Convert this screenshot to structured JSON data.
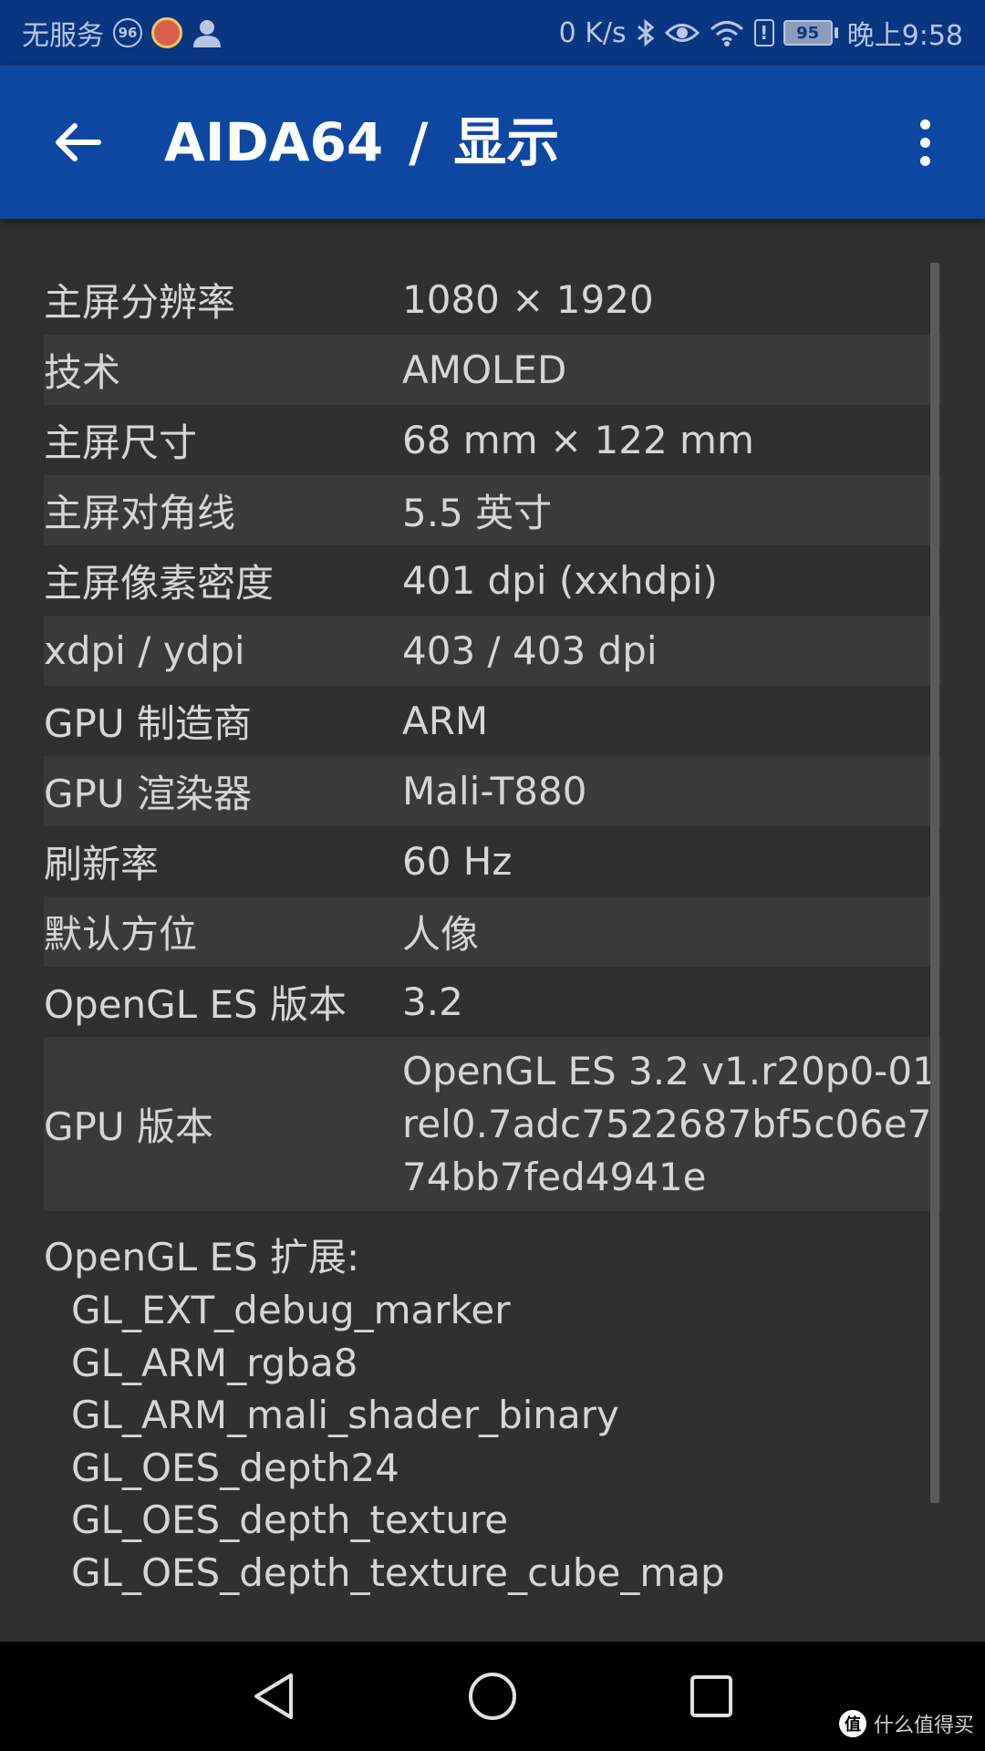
{
  "status_bar": {
    "carrier": "无服务",
    "notification_count": "96",
    "network_speed": "0 K/s",
    "battery": "95",
    "time": "晚上9:58",
    "icons": [
      "user-icon",
      "bluetooth-icon",
      "eye-icon",
      "wifi-icon",
      "alert-icon",
      "battery-icon"
    ]
  },
  "app_bar": {
    "app_name": "AIDA64",
    "separator": "/",
    "section": "显示",
    "back_icon": "arrow-left-icon",
    "menu_icon": "more-vert-icon"
  },
  "rows": [
    {
      "label": "主屏分辨率",
      "value": "1080 × 1920"
    },
    {
      "label": "技术",
      "value": "AMOLED"
    },
    {
      "label": "主屏尺寸",
      "value": "68 mm × 122 mm"
    },
    {
      "label": "主屏对角线",
      "value": "5.5 英寸"
    },
    {
      "label": "主屏像素密度",
      "value": "401 dpi (xxhdpi)"
    },
    {
      "label": "xdpi / ydpi",
      "value": "403 / 403 dpi"
    },
    {
      "label": "GPU 制造商",
      "value": "ARM"
    },
    {
      "label": "GPU 渲染器",
      "value": "Mali-T880"
    },
    {
      "label": "刷新率",
      "value": "60 Hz"
    },
    {
      "label": "默认方位",
      "value": "人像"
    },
    {
      "label": "OpenGL ES 版本",
      "value": "3.2"
    }
  ],
  "gpu_version": {
    "label": "GPU 版本",
    "lines": [
      "OpenGL ES 3.2 v1.r20p0-01",
      "rel0.7adc7522687bf5c06e7",
      "74bb7fed4941e"
    ]
  },
  "extensions": {
    "title": "OpenGL ES 扩展:",
    "items": [
      "GL_EXT_debug_marker",
      "GL_ARM_rgba8",
      "GL_ARM_mali_shader_binary",
      "GL_OES_depth24",
      "GL_OES_depth_texture",
      "GL_OES_depth_texture_cube_map"
    ]
  },
  "nav_bar": {
    "icons": [
      "back-triangle-icon",
      "home-circle-icon",
      "recents-square-icon"
    ]
  },
  "watermark": {
    "badge": "值",
    "text": "什么值得买"
  },
  "colors": {
    "status_bar": "#0a3580",
    "app_bar": "#0d47a1",
    "background": "#303030",
    "row_alt": "#3a3a3a",
    "text": "#d6d6d6",
    "nav_bar": "#000000"
  }
}
